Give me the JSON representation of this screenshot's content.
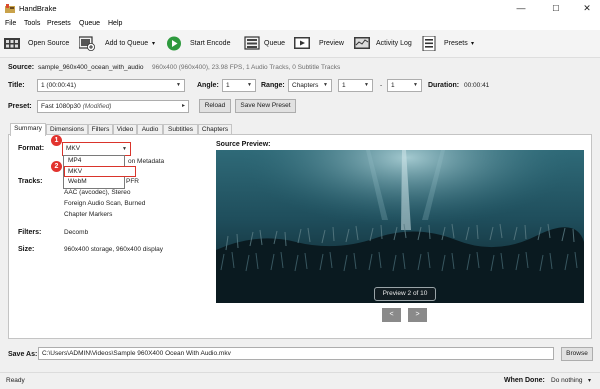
{
  "window": {
    "title": "HandBrake",
    "minimize": "—",
    "maximize": "☐",
    "close": "✕"
  },
  "menu": [
    "File",
    "Tools",
    "Presets",
    "Queue",
    "Help"
  ],
  "toolbar": {
    "open_source": "Open Source",
    "add_to_queue": "Add to Queue",
    "add_to_queue_caret": "▾",
    "start_encode": "Start Encode",
    "queue": "Queue",
    "preview": "Preview",
    "activity_log": "Activity Log",
    "presets": "Presets",
    "presets_caret": "▾"
  },
  "source": {
    "label": "Source:",
    "name": "sample_960x400_ocean_with_audio",
    "details": "960x400 (960x400), 23.98 FPS, 1 Audio Tracks, 0 Subtitle Tracks"
  },
  "title_row": {
    "title_label": "Title:",
    "title_value": "1 (00:00:41)",
    "angle_label": "Angle:",
    "angle_value": "1",
    "range_label": "Range:",
    "range_mode": "Chapters",
    "range_start": "1",
    "range_sep": "-",
    "range_end": "1",
    "duration_label": "Duration:",
    "duration_value": "00:00:41"
  },
  "preset": {
    "label": "Preset:",
    "value": "Fast 1080p30",
    "modified": "(Modified)",
    "arrow": "▸",
    "reload": "Reload",
    "save_new": "Save New Preset"
  },
  "tabs": [
    "Summary",
    "Dimensions",
    "Filters",
    "Video",
    "Audio",
    "Subtitles",
    "Chapters"
  ],
  "summary": {
    "format_label": "Format:",
    "format_value": "MKV",
    "format_options": [
      "MP4",
      "MKV",
      "WebM"
    ],
    "passthru_text": "on Metadata",
    "tracks_label": "Tracks:",
    "tracks_fragment": "PFR",
    "tracks_lines": [
      "AAC (avcodec), Stereo",
      "Foreign Audio Scan, Burned",
      "Chapter Markers"
    ],
    "filters_label": "Filters:",
    "filters_value": "Decomb",
    "size_label": "Size:",
    "size_value": "960x400 storage, 960x400 display",
    "markers": [
      "1",
      "2"
    ]
  },
  "preview": {
    "label": "Source Preview:",
    "badge": "Preview 2 of 10",
    "prev": "<",
    "next": ">"
  },
  "save_as": {
    "label": "Save As:",
    "path": "C:\\Users\\ADMIN\\Videos\\Sample 960X400 Ocean With Audio.mkv",
    "browse": "Browse"
  },
  "status": {
    "state": "Ready",
    "when_done_label": "When Done:",
    "when_done_value": "Do nothing",
    "when_done_caret": "▾"
  },
  "colors": {
    "highlight": "#d9342b",
    "start_green": "#2e9a3e",
    "preview_sea": "#1f4e5c"
  }
}
